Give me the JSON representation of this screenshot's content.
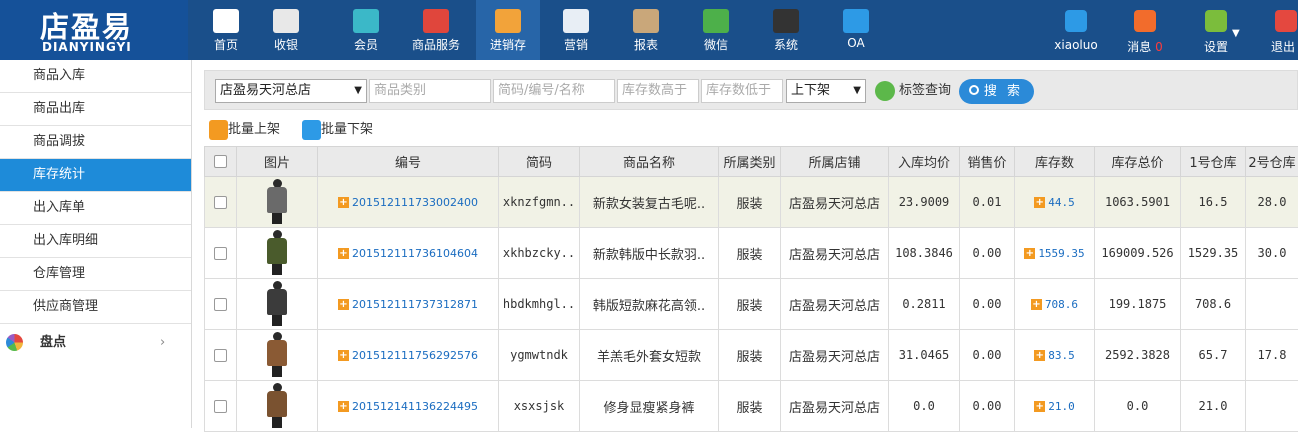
{
  "brand": {
    "name_cn": "店盈易",
    "name_en": "DIANYINGYI"
  },
  "nav": [
    {
      "label": "首页",
      "icon": "home-icon",
      "color": "#ffffff"
    },
    {
      "label": "收银",
      "icon": "cash-register-icon",
      "color": "#e8e8e8"
    },
    {
      "label": "会员",
      "icon": "member-icon",
      "color": "#3bb8c8"
    },
    {
      "label": "商品服务",
      "icon": "goods-icon",
      "color": "#e0463c"
    },
    {
      "label": "进销存",
      "icon": "inventory-icon",
      "color": "#f2a33a"
    },
    {
      "label": "营销",
      "icon": "megaphone-icon",
      "color": "#e8eef5"
    },
    {
      "label": "报表",
      "icon": "report-icon",
      "color": "#c9a77a"
    },
    {
      "label": "微信",
      "icon": "wechat-icon",
      "color": "#4db04a"
    },
    {
      "label": "系统",
      "icon": "monitor-icon",
      "color": "#333333"
    },
    {
      "label": "OA",
      "icon": "oa-icon",
      "color": "#2d9ae6"
    }
  ],
  "user_nav": {
    "user": "xiaoluo",
    "messages_label": "消息",
    "messages_count": "0",
    "settings_label": "设置",
    "logout_label": "退出"
  },
  "sidebar": {
    "items": [
      "商品入库",
      "商品出库",
      "商品调拔",
      "库存统计",
      "出入库单",
      "出入库明细",
      "仓库管理",
      "供应商管理"
    ],
    "active": "库存统计",
    "group": "盘点"
  },
  "filters": {
    "store": "店盈易天河总店",
    "category_placeholder": "商品类别",
    "code_placeholder": "简码/编号/名称",
    "stock_high_placeholder": "库存数高于",
    "stock_low_placeholder": "库存数低于",
    "shelf_status": "上下架",
    "tag_query": "标签查询",
    "search": "搜 索"
  },
  "actions": {
    "batch_on": "批量上架",
    "batch_off": "批量下架"
  },
  "table": {
    "headers": [
      "图片",
      "编号",
      "简码",
      "商品名称",
      "所属类别",
      "所属店铺",
      "入库均价",
      "销售价",
      "库存数",
      "库存总价",
      "1号仓库",
      "2号仓库"
    ],
    "rows": [
      {
        "code": "201512111733002400",
        "short": "xknzfgmn..",
        "name": "新款女装复古毛呢..",
        "category": "服装",
        "store": "店盈易天河总店",
        "avg_in": "23.9009",
        "price": "0.01",
        "stock": "44.5",
        "total": "1063.5901",
        "wh1": "16.5",
        "wh2": "28.0",
        "coat": "#6a6a6a"
      },
      {
        "code": "201512111736104604",
        "short": "xkhbzcky..",
        "name": "新款韩版中长款羽..",
        "category": "服装",
        "store": "店盈易天河总店",
        "avg_in": "108.3846",
        "price": "0.00",
        "stock": "1559.35",
        "total": "169009.526",
        "wh1": "1529.35",
        "wh2": "30.0",
        "coat": "#4a5b2c"
      },
      {
        "code": "201512111737312871",
        "short": "hbdkmhgl..",
        "name": "韩版短款麻花高领..",
        "category": "服装",
        "store": "店盈易天河总店",
        "avg_in": "0.2811",
        "price": "0.00",
        "stock": "708.6",
        "total": "199.1875",
        "wh1": "708.6",
        "wh2": "",
        "coat": "#3b3b3b"
      },
      {
        "code": "201512111756292576",
        "short": "ygmwtndk",
        "name": "羊羔毛外套女短款",
        "category": "服装",
        "store": "店盈易天河总店",
        "avg_in": "31.0465",
        "price": "0.00",
        "stock": "83.5",
        "total": "2592.3828",
        "wh1": "65.7",
        "wh2": "17.8",
        "coat": "#8a5a34"
      },
      {
        "code": "201512141136224495",
        "short": "xsxsjsk",
        "name": "修身显瘦紧身裤",
        "category": "服装",
        "store": "店盈易天河总店",
        "avg_in": "0.0",
        "price": "0.00",
        "stock": "21.0",
        "total": "0.0",
        "wh1": "21.0",
        "wh2": "",
        "coat": "#7a5230"
      }
    ]
  }
}
